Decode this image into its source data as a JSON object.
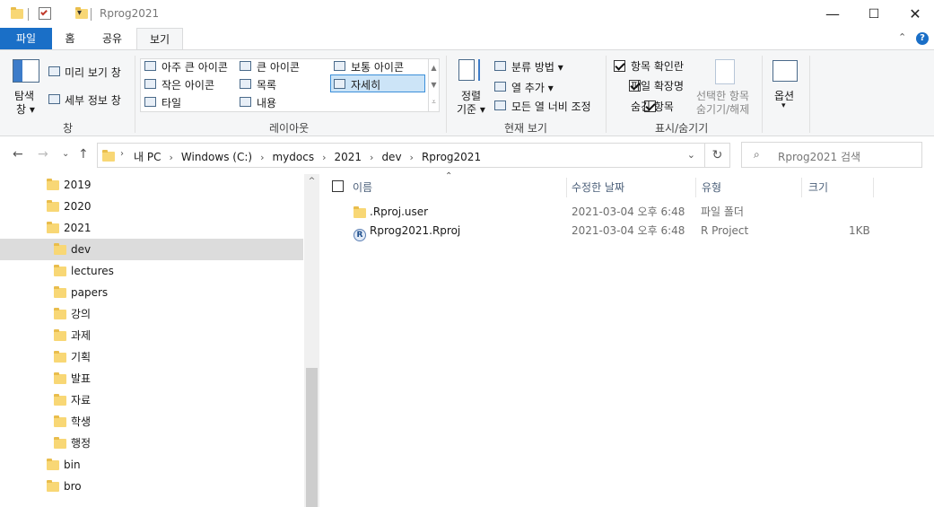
{
  "window": {
    "title": "Rprog2021",
    "controls": {
      "minimize": "—",
      "maximize": "☐",
      "close": "✕"
    }
  },
  "ribbon_tabs": {
    "file": "파일",
    "home": "홈",
    "share": "공유",
    "view": "보기"
  },
  "ribbon": {
    "pane_group": {
      "navigation_pane": "탐색",
      "navigation_pane_2": "창",
      "preview_pane": "미리 보기 창",
      "details_pane": "세부 정보 창",
      "label": "창"
    },
    "layout_group": {
      "extra_large_icons": "아주 큰 아이콘",
      "large_icons": "큰 아이콘",
      "medium_icons": "보통 아이콘",
      "small_icons": "작은 아이콘",
      "list": "목록",
      "details": "자세히",
      "tiles": "타일",
      "content": "내용",
      "label": "레이아웃"
    },
    "current_view_group": {
      "sort_by": "정렬",
      "sort_by_2": "기준",
      "group_by": "분류 방법",
      "add_columns": "열 추가",
      "size_all_columns": "모든 열 너비 조정",
      "label": "현재 보기"
    },
    "show_hide_group": {
      "item_check_boxes": "항목 확인란",
      "file_name_extensions": "파일 확장명",
      "hidden_items": "숨긴 항목",
      "hide_selected": "선택한 항목",
      "hide_selected_2": "숨기기/해제",
      "label": "표시/숨기기"
    },
    "options": "옵션"
  },
  "address": {
    "breadcrumb": [
      "내 PC",
      "Windows (C:)",
      "mydocs",
      "2021",
      "dev",
      "Rprog2021"
    ]
  },
  "search": {
    "placeholder": "Rprog2021 검색"
  },
  "nav_tree": [
    {
      "label": "2019",
      "indent": 1
    },
    {
      "label": "2020",
      "indent": 1
    },
    {
      "label": "2021",
      "indent": 1
    },
    {
      "label": "dev",
      "indent": 2,
      "selected": true
    },
    {
      "label": "lectures",
      "indent": 2
    },
    {
      "label": "papers",
      "indent": 2
    },
    {
      "label": "강의",
      "indent": 2
    },
    {
      "label": "과제",
      "indent": 2
    },
    {
      "label": "기획",
      "indent": 2
    },
    {
      "label": "발표",
      "indent": 2
    },
    {
      "label": "자료",
      "indent": 2
    },
    {
      "label": "학생",
      "indent": 2
    },
    {
      "label": "행정",
      "indent": 2
    },
    {
      "label": "bin",
      "indent": 1
    },
    {
      "label": "bro",
      "indent": 1
    }
  ],
  "columns": {
    "name": "이름",
    "date_modified": "수정한 날짜",
    "type": "유형",
    "size": "크기"
  },
  "files": [
    {
      "name": ".Rproj.user",
      "date": "2021-03-04 오후 6:48",
      "type": "파일 폴더",
      "size": "",
      "icon": "folder-icon"
    },
    {
      "name": "Rprog2021.Rproj",
      "date": "2021-03-04 오후 6:48",
      "type": "R Project",
      "size": "1KB",
      "icon": "rproj-icon"
    }
  ]
}
